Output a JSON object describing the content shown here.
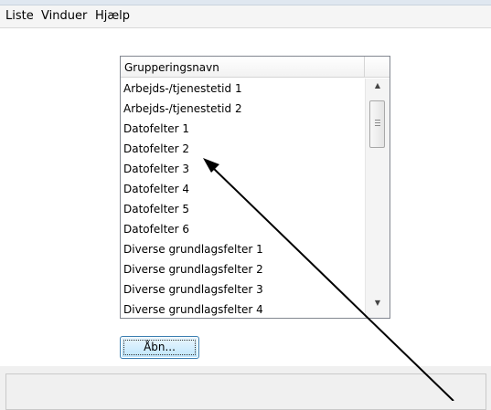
{
  "menubar": {
    "items": [
      {
        "label": "Liste"
      },
      {
        "label": "Vinduer"
      },
      {
        "label": "Hjælp"
      }
    ]
  },
  "list": {
    "header": "Grupperingsnavn",
    "rows": [
      "Arbejds-/tjenestetid 1",
      "Arbejds-/tjenestetid 2",
      "Datofelter 1",
      "Datofelter 2",
      "Datofelter 3",
      "Datofelter 4",
      "Datofelter 5",
      "Datofelter 6",
      "Diverse grundlagsfelter 1",
      "Diverse grundlagsfelter 2",
      "Diverse grundlagsfelter 3",
      "Diverse grundlagsfelter 4"
    ]
  },
  "buttons": {
    "open_label": "Åbn..."
  },
  "annotation": {
    "color": "#000000"
  }
}
